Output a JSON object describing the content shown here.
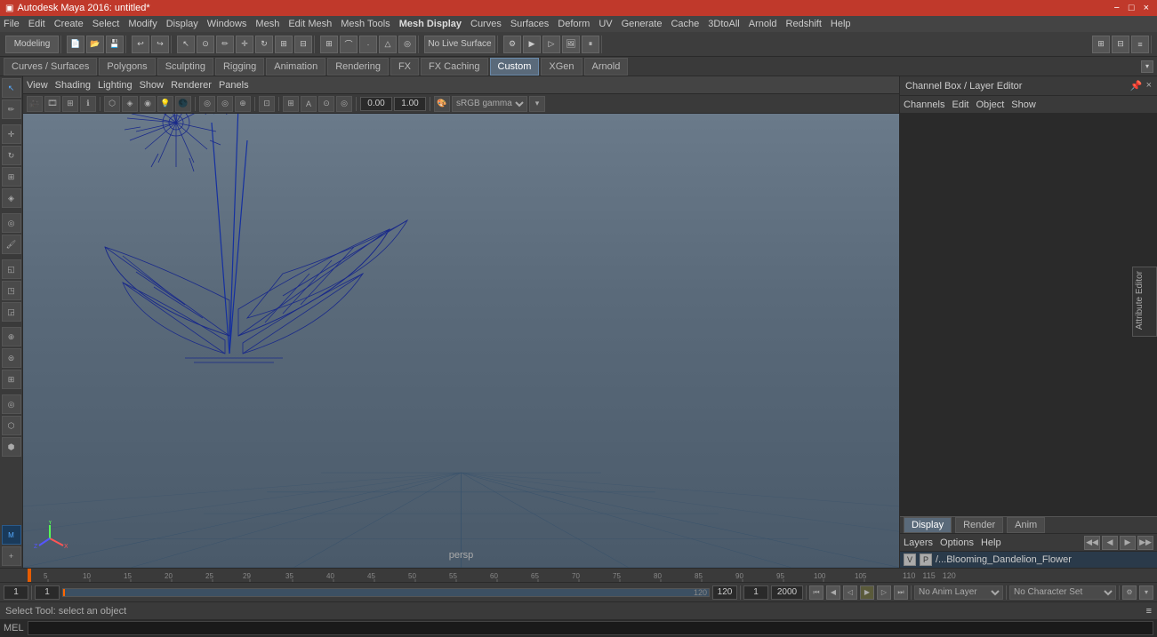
{
  "titleBar": {
    "title": "Autodesk Maya 2016: untitled*",
    "controls": [
      "−",
      "□",
      "×"
    ]
  },
  "menuBar": {
    "items": [
      "File",
      "Edit",
      "Create",
      "Select",
      "Modify",
      "Display",
      "Windows",
      "Mesh",
      "Edit Mesh",
      "Mesh Tools",
      "Mesh Display",
      "Curves",
      "Surfaces",
      "Deform",
      "UV",
      "Generate",
      "Cache",
      "3DtoAll",
      "Arnold",
      "Redshift",
      "Help"
    ]
  },
  "toolbar": {
    "workspaceLabel": "Modeling",
    "liveLabel": "No Live Surface"
  },
  "shelves": {
    "tabs": [
      "Curves / Surfaces",
      "Polygons",
      "Sculpting",
      "Rigging",
      "Animation",
      "Rendering",
      "FX",
      "FX Caching",
      "Custom",
      "XGen",
      "Arnold"
    ],
    "activeTab": "Custom"
  },
  "viewport": {
    "menuItems": [
      "View",
      "Shading",
      "Lighting",
      "Show",
      "Renderer",
      "Panels"
    ],
    "cameraLabel": "persp",
    "colorProfile": "sRGB gamma",
    "valueA": "0.00",
    "valueB": "1.00"
  },
  "rightPanel": {
    "title": "Channel Box / Layer Editor",
    "menuItems": [
      "Channels",
      "Edit",
      "Object",
      "Show"
    ],
    "bottomTabs": [
      "Display",
      "Render",
      "Anim"
    ],
    "activeTab": "Display",
    "layerMenuItems": [
      "Layers",
      "Options",
      "Help"
    ],
    "layerControls": [
      "◀◀",
      "◀",
      "▶",
      "▶▶"
    ],
    "layerItem": {
      "visible": "V",
      "playback": "P",
      "name": "/...Blooming_Dandelion_Flower"
    }
  },
  "timeline": {
    "markers": [
      "5",
      "10",
      "15",
      "20",
      "25",
      "29",
      "35",
      "40",
      "45",
      "50",
      "55",
      "60",
      "65",
      "70",
      "75",
      "80",
      "85",
      "90",
      "95",
      "100",
      "105",
      "110",
      "115",
      "120"
    ],
    "currentFrame": "1",
    "startFrame": "1",
    "endFrame": "120",
    "rangeStart": "1",
    "rangeEnd": "120",
    "playbackEnd": "2000"
  },
  "transport": {
    "buttons": [
      "⏮",
      "⏪",
      "◀",
      "▶",
      "⏩",
      "⏭"
    ],
    "loopBtn": "↺",
    "animLayer": "No Anim Layer",
    "charSet": "No Character Set"
  },
  "statusBar": {
    "text": "Select Tool: select an object",
    "melLabel": "MEL"
  },
  "bottomBar": {
    "frameStart": "1",
    "frameEnd": "1"
  }
}
